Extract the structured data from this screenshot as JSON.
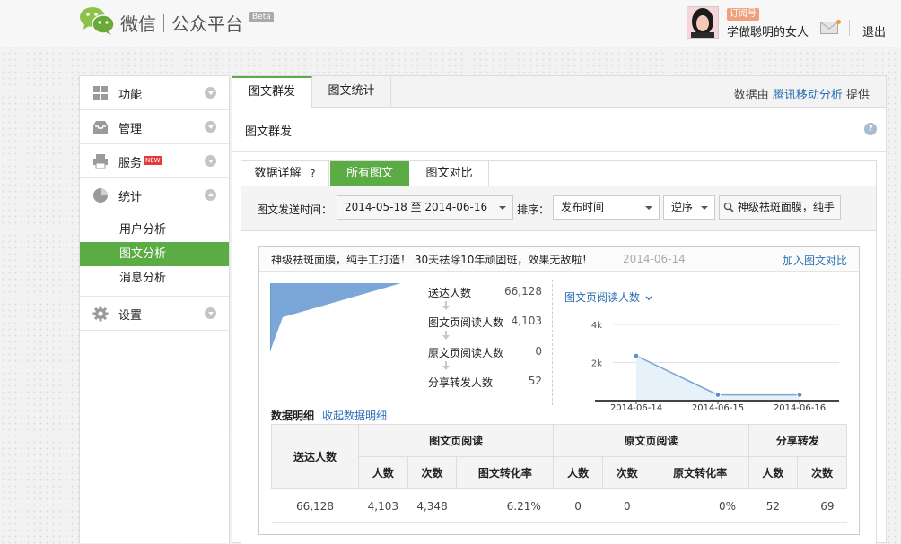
{
  "header": {
    "brand_main": "微信",
    "brand_sub": "公众平台",
    "beta": "Beta",
    "account_badge": "订阅号",
    "account_name": "学做聪明的女人",
    "logout": "退出"
  },
  "sidebar": {
    "items": [
      {
        "label": "功能",
        "icon": "function-grid-icon",
        "expanded": false
      },
      {
        "label": "管理",
        "icon": "inbox-icon",
        "expanded": false
      },
      {
        "label": "服务",
        "icon": "printer-icon",
        "new_badge": "NEW",
        "expanded": false
      },
      {
        "label": "统计",
        "icon": "pie-chart-icon",
        "expanded": true
      },
      {
        "label": "设置",
        "icon": "gear-icon",
        "expanded": false
      }
    ],
    "stats_subitems": [
      {
        "label": "用户分析",
        "active": false
      },
      {
        "label": "图文分析",
        "active": true
      },
      {
        "label": "消息分析",
        "active": false
      }
    ]
  },
  "main": {
    "tabs": [
      {
        "label": "图文群发",
        "active": true
      },
      {
        "label": "图文统计",
        "active": false
      }
    ],
    "provider_prefix": "数据由",
    "provider_link": "腾讯移动分析",
    "provider_suffix": "提供",
    "section_title": "图文群发",
    "help_icon": "?"
  },
  "inner": {
    "tab_detail": "数据详解",
    "tab_detail_help": "?",
    "tab_all": "所有图文",
    "tab_compare": "图文对比",
    "filters": {
      "time_label": "图文发送时间：",
      "date_range": "2014-05-18 至 2014-06-16",
      "sort_label": "排序：",
      "sort_value": "发布时间",
      "order_value": "逆序",
      "search_value": "神级祛斑面膜，纯手"
    }
  },
  "article": {
    "title": "神级祛斑面膜，纯手工打造！ 30天祛除10年顽固斑，效果无敌啦！",
    "date": "2014-06-14",
    "add_compare": "加入图文对比",
    "funnel": [
      {
        "label": "送达人数",
        "value": "66,128"
      },
      {
        "label": "图文页阅读人数",
        "value": "4,103"
      },
      {
        "label": "原文页阅读人数",
        "value": "0"
      },
      {
        "label": "分享转发人数",
        "value": "52"
      }
    ],
    "metric_select": "图文页阅读人数",
    "detail_title": "数据明细",
    "detail_toggle": "收起数据明细",
    "table": {
      "col_reach": "送达人数",
      "group_page": "图文页阅读",
      "group_orig": "原文页阅读",
      "group_share": "分享转发",
      "sub_people": "人数",
      "sub_times": "次数",
      "sub_page_rate": "图文转化率",
      "sub_orig_rate": "原文转化率",
      "row": [
        "66,128",
        "4,103",
        "4,348",
        "6.21%",
        "0",
        "0",
        "0%",
        "52",
        "69"
      ]
    }
  },
  "chart_data": {
    "type": "line",
    "x": [
      "2014-06-14",
      "2014-06-15",
      "2014-06-16"
    ],
    "series": [
      {
        "values": [
          2350,
          300,
          300
        ]
      }
    ],
    "yticks": [
      "4k",
      "2k"
    ],
    "ylim": [
      0,
      4000
    ],
    "grid": true,
    "color": "#7ea6cf"
  }
}
